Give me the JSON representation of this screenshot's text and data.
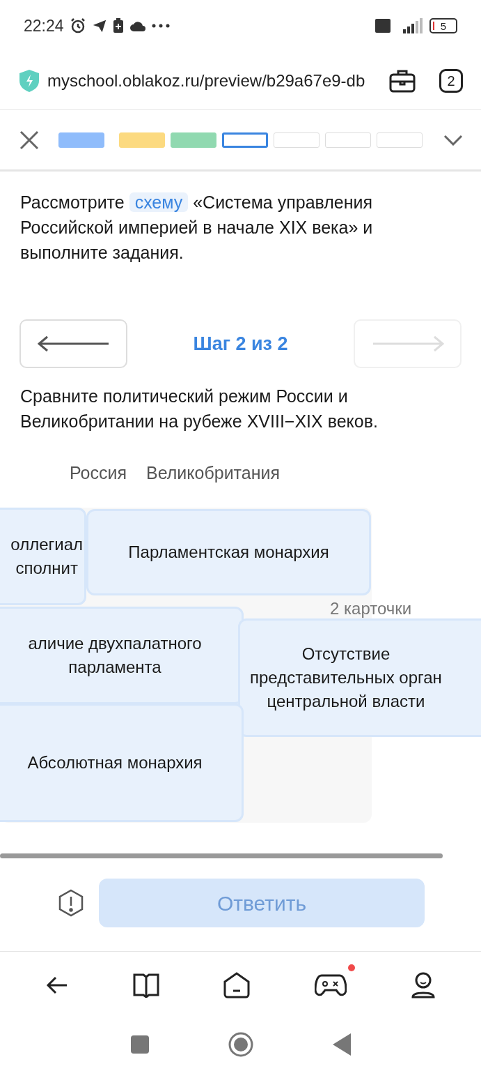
{
  "status_bar": {
    "time": "22:24",
    "battery": "5"
  },
  "browser": {
    "url": "myschool.oblakoz.ru/preview/b29a67e9-db",
    "tab_count": "2"
  },
  "progress": [
    {
      "color": "#8fbcfb",
      "selected": false
    },
    {
      "color": "#fcda80",
      "selected": false
    },
    {
      "color": "#90d9b0",
      "selected": false
    },
    {
      "color": "#ffffff",
      "selected": true
    },
    {
      "color": "#ffffff",
      "selected": false
    },
    {
      "color": "#ffffff",
      "selected": false
    },
    {
      "color": "#ffffff",
      "selected": false
    }
  ],
  "intro": {
    "before": "Рассмотрите",
    "link": "схему",
    "after": "«Система управления Российской империей в начале XIX века» и выполните задания."
  },
  "stepper": {
    "label": "Шаг 2 из 2",
    "prev_disabled": false,
    "next_disabled": true
  },
  "question": "Сравните политический режим России и Великобритании на рубеже XVIII−XIX веков.",
  "columns": [
    "Россия",
    "Великобритания"
  ],
  "cards_count": "2 карточки",
  "cards": [
    {
      "lines": [
        "оллегиал",
        "сполнит"
      ]
    },
    {
      "lines": [
        "Парламентская монархия"
      ]
    },
    {
      "lines": [
        "аличие двухпалатного",
        "парламента"
      ]
    },
    {
      "lines": [
        "Отсутствие",
        "представительных орган",
        "центральной власти"
      ]
    },
    {
      "lines": [
        "Абсолютная монархия"
      ]
    }
  ],
  "answer_button": {
    "label": "Ответить",
    "disabled": true
  },
  "bottom_nav": {
    "notification_dot": true
  }
}
